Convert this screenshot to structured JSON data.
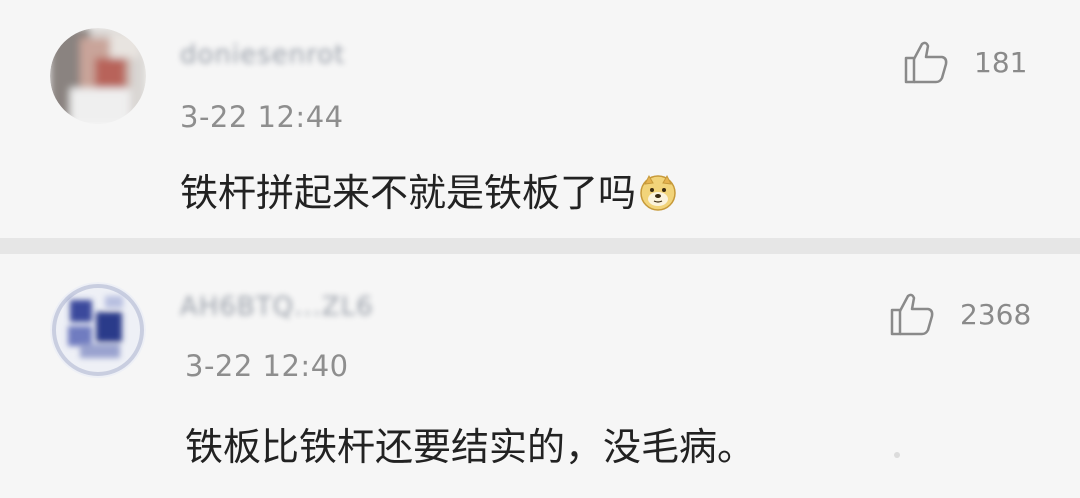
{
  "comments": [
    {
      "username": "doniesenrot",
      "timestamp": "3-22 12:44",
      "text": "铁杆拼起来不就是铁板了吗",
      "emoji": "doge-emoji",
      "like_count": "181",
      "like_icon": "thumbs-up-icon"
    },
    {
      "username": "AH6BTQ...ZL6",
      "timestamp": "3-22 12:40",
      "text": "铁板比铁杆还要结实的，没毛病。",
      "like_count": "2368",
      "like_icon": "thumbs-up-icon"
    }
  ],
  "colors": {
    "background": "#f6f6f6",
    "divider": "#e6e6e6",
    "text": "#222222",
    "meta": "#8e8e8e"
  }
}
